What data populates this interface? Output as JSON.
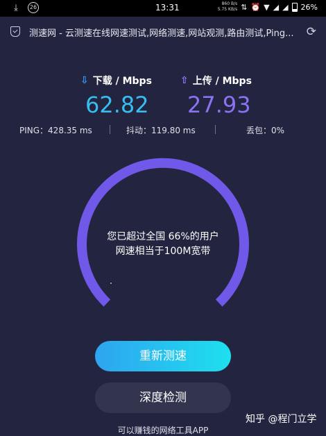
{
  "status_bar": {
    "download_icon": "download-arrow-icon",
    "badge": "26",
    "time": "13:31",
    "net_up": "860 B/s",
    "net_down": "5.75 KB/s",
    "battery": "26%"
  },
  "url_bar": {
    "title": "测速网 - 云测速在线网速测试,网络测速,网站观测,路由测试,Ping..."
  },
  "speed": {
    "download_label": "下载 / Mbps",
    "download_value": "62.82",
    "upload_label": "上传 / Mbps",
    "upload_value": "27.93"
  },
  "stats": {
    "ping": "PING：428.35 ms",
    "jitter": "抖动：119.80 ms",
    "loss": "丢包：0%"
  },
  "gauge": {
    "line1": "您已超过全国 66%的用户",
    "line2": "网速相当于100M宽带"
  },
  "buttons": {
    "retest": "重新测速",
    "deep_check": "深度检测"
  },
  "promo": "可以赚钱的网络工具APP",
  "watermark": "知乎 @程门立学",
  "colors": {
    "background": "#232540",
    "download": "#38bdf0",
    "upload": "#8a72f2",
    "gauge": "#7059e8"
  }
}
